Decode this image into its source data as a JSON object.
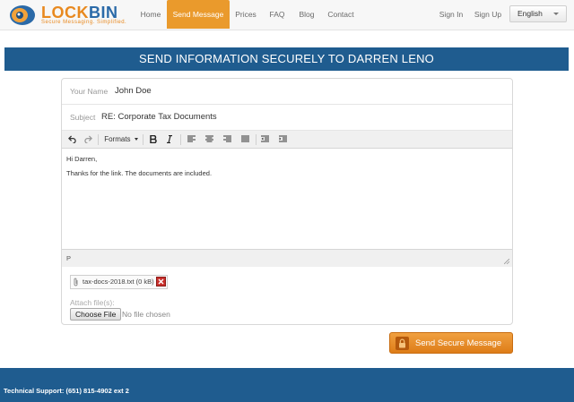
{
  "brand": {
    "name_part1": "LOCK",
    "name_part2": "BIN",
    "tagline": "Secure Messaging. Simplified."
  },
  "nav": {
    "items": [
      {
        "label": "Home",
        "active": false
      },
      {
        "label": "Send Message",
        "active": true
      },
      {
        "label": "Prices",
        "active": false
      },
      {
        "label": "FAQ",
        "active": false
      },
      {
        "label": "Blog",
        "active": false
      },
      {
        "label": "Contact",
        "active": false
      }
    ],
    "sign_in": "Sign In",
    "sign_up": "Sign Up",
    "language": "English"
  },
  "banner": {
    "title": "SEND INFORMATION SECURELY TO DARREN LENO"
  },
  "form": {
    "name_label": "Your Name",
    "name_value": "John Doe",
    "subject_label": "Subject",
    "subject_value": "RE: Corporate Tax Documents",
    "toolbar": {
      "formats_label": "Formats"
    },
    "body": {
      "greeting": "Hi Darren,",
      "line": "Thanks for the link. The documents are included."
    },
    "status_path": "P",
    "attachment": {
      "name": "tax-docs-2018.txt (0 kB)"
    },
    "attach_label": "Attach file(s):",
    "choose_label": "Choose File",
    "no_file": "No file chosen"
  },
  "send_button": {
    "label": "Send Secure Message"
  },
  "footer": {
    "support": "Technical Support: (651) 815-4902 ext 2"
  },
  "colors": {
    "primary": "#1f5c8f",
    "accent": "#ea9a2c",
    "danger": "#c9302c"
  }
}
